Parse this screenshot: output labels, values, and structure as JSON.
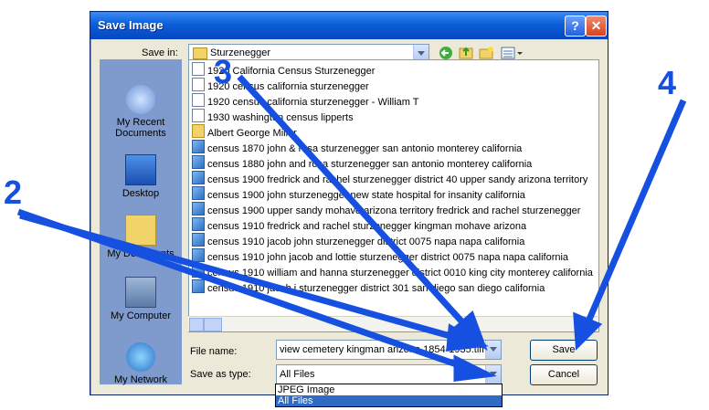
{
  "dialog": {
    "title": "Save Image",
    "help_button": "?",
    "close_button": "✕",
    "save_in_label": "Save in:",
    "save_in_value": "Sturzenegger",
    "places": [
      "My Recent Documents",
      "Desktop",
      "My Documents",
      "My Computer",
      "My Network"
    ],
    "files": [
      {
        "name": "1920 California Census Sturzenegger",
        "icon": "doc-icon"
      },
      {
        "name": "1920 census california sturzenegger",
        "icon": "doc-icon"
      },
      {
        "name": "1920 census california sturzenegger - William T",
        "icon": "doc-icon"
      },
      {
        "name": "1930 washington census lipperts",
        "icon": "doc-icon"
      },
      {
        "name": "Albert George Miller",
        "icon": "folder-icon"
      },
      {
        "name": "census 1870 john & rosa sturzenegger san antonio monterey california",
        "icon": "image-icon"
      },
      {
        "name": "census 1880 john and rosa sturzenegger san antonio monterey california",
        "icon": "image-icon"
      },
      {
        "name": "census 1900 fredrick and rachel sturzenegger district 40 upper sandy arizona territory",
        "icon": "image-icon"
      },
      {
        "name": "census 1900 john sturzenegger new state hospital for insanity california",
        "icon": "image-icon"
      },
      {
        "name": "census 1900 upper sandy mohave arizona territory fredrick and rachel sturzenegger",
        "icon": "image-icon"
      },
      {
        "name": "census 1910  fredrick and rachel sturzenegger kingman mohave arizona",
        "icon": "image-icon"
      },
      {
        "name": "census 1910 jacob john sturzenegger district 0075 napa napa california",
        "icon": "image-icon"
      },
      {
        "name": "census 1910 john jacob and lottie sturzenegger district 0075 napa napa california",
        "icon": "image-icon"
      },
      {
        "name": "census 1910 william and hanna sturzenegger district 0010 king city monterey california",
        "icon": "image-icon"
      },
      {
        "name": "census 1910 jacob j sturzenegger district 301 san diego san diego california",
        "icon": "image-icon"
      }
    ],
    "file_name_label": "File name:",
    "file_name_value": "view cemetery kingman arizona 1854-1935.tiff",
    "save_as_type_label": "Save as type:",
    "save_as_type_value": "All Files",
    "type_options": [
      "JPEG Image",
      "All Files"
    ],
    "save_button": "Save",
    "cancel_button": "Cancel"
  },
  "annotations": [
    "2",
    "3",
    "4"
  ],
  "colors": {
    "title_bar": "#0a5fd8",
    "arrow": "#1650e0",
    "dialog_bg": "#ece9d8",
    "places_bg": "#7f9acc"
  }
}
